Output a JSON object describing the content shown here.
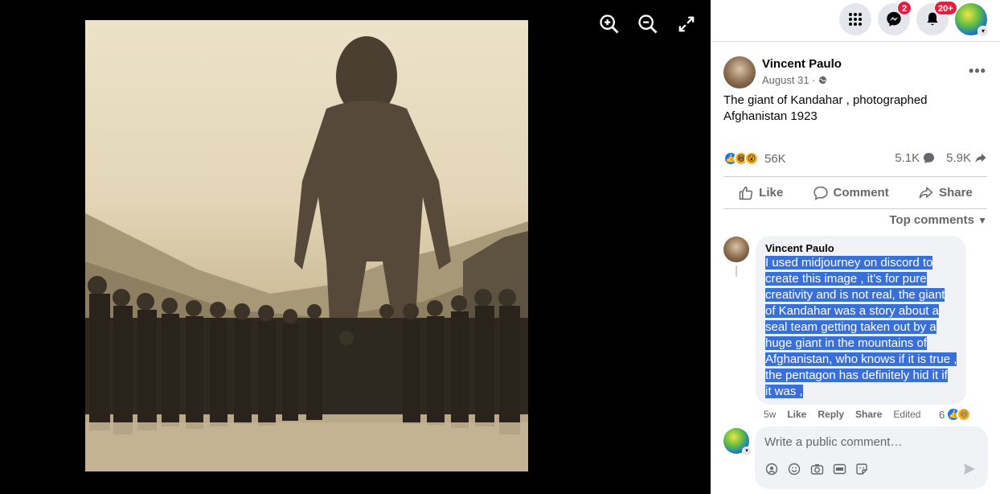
{
  "topbar": {
    "messenger_badge": "2",
    "notifications_badge": "20+"
  },
  "post": {
    "author": "Vincent Paulo",
    "date": "August 31 ·",
    "text": "The giant of Kandahar , photographed Afghanistan 1923",
    "reactions_count": "56K",
    "comments_count": "5.1K",
    "shares_count": "5.9K"
  },
  "actions": {
    "like": "Like",
    "comment": "Comment",
    "share": "Share"
  },
  "comments_sort": "Top comments",
  "comment": {
    "author": "Vincent Paulo",
    "lines": [
      "I used midjourney on discord to",
      "create this image , it’s for pure",
      "creativity and is not real, the giant",
      "of Kandahar was a story about a",
      "seal team getting taken out by a",
      "huge giant in the mountains of",
      "Afghanistan, who knows if it is true ,",
      "the pentagon has definitely hid it if",
      "it was ,"
    ],
    "time": "5w",
    "like": "Like",
    "reply": "Reply",
    "share": "Share",
    "edited": "Edited",
    "reaction_count": "6"
  },
  "composer": {
    "placeholder": "Write a public comment…"
  },
  "colors": {
    "accent": "#1877f2",
    "badge": "#e41e3f",
    "selection": "#3b6fd8"
  },
  "icons": [
    "zoom-in-icon",
    "zoom-out-icon",
    "fullscreen-icon",
    "menu-grid-icon",
    "messenger-icon",
    "bell-icon",
    "globe-icon",
    "like-icon",
    "comment-icon",
    "share-icon",
    "chevron-down-icon",
    "send-icon"
  ]
}
